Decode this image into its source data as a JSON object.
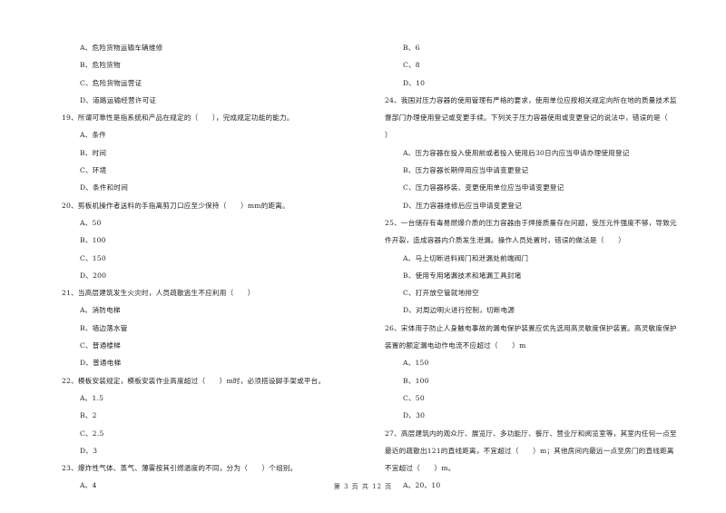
{
  "page": {
    "left_column": [
      {
        "type": "option",
        "text": "A、危险货物运输车辆维修"
      },
      {
        "type": "option",
        "text": "B、危险货物"
      },
      {
        "type": "option",
        "text": "C、危险货物运营证"
      },
      {
        "type": "option",
        "text": "D、道路运输经营许可证"
      },
      {
        "type": "question",
        "text": "19、所谓可靠性是指系统和产品在规定的（　　），完成规定功能的能力。"
      },
      {
        "type": "option",
        "text": "A、条件"
      },
      {
        "type": "option",
        "text": "B、时间"
      },
      {
        "type": "option",
        "text": "C、环境"
      },
      {
        "type": "option",
        "text": "D、条件和时间"
      },
      {
        "type": "question",
        "text": "20、剪板机操作者送料的手指离剪刀口应至少保持（　　）mm的距离。"
      },
      {
        "type": "option",
        "text": "A、50"
      },
      {
        "type": "option",
        "text": "B、100"
      },
      {
        "type": "option",
        "text": "C、150"
      },
      {
        "type": "option",
        "text": "D、200"
      },
      {
        "type": "question",
        "text": "21、当高层建筑发生火灾时，人员疏散逃生不应利用（　　）"
      },
      {
        "type": "option",
        "text": "A、消防电梯"
      },
      {
        "type": "option",
        "text": "B、墙边落水管"
      },
      {
        "type": "option",
        "text": "C、普通楼梯"
      },
      {
        "type": "option",
        "text": "D、普通电梯"
      },
      {
        "type": "question",
        "text": "22、模板安装规定，模板安装作业高度超过（　　）m时，必须搭设脚手架或平台。"
      },
      {
        "type": "option",
        "text": "A、1.5"
      },
      {
        "type": "option",
        "text": "B、2"
      },
      {
        "type": "option",
        "text": "C、2.5"
      },
      {
        "type": "option",
        "text": "D、3"
      },
      {
        "type": "question",
        "text": "23、爆炸性气体、蒸气、薄雾按其引燃温度的不同，分为（　　）个组别。"
      },
      {
        "type": "option",
        "text": "A、4"
      }
    ],
    "right_column": [
      {
        "type": "option",
        "text": "B、6"
      },
      {
        "type": "option",
        "text": "C、8"
      },
      {
        "type": "option",
        "text": "D、10"
      },
      {
        "type": "question",
        "text": "24、我国对压力容器的使用管理有严格的要求，使用单位应按相关规定向所在地的质量技术监"
      },
      {
        "type": "question",
        "text": "督部门办理使用登记或变更手续。下列关于压力容器使用或变更登记的说法中，错误的是（"
      },
      {
        "type": "question",
        "text": "）"
      },
      {
        "type": "option",
        "text": "A、压力容器在投入使用前或者投入使用后30日内应当申请办理使用登记"
      },
      {
        "type": "option",
        "text": "B、压力容器长期停用应当申请变更登记"
      },
      {
        "type": "option",
        "text": "C、压力容器移装、变更使用单位应当申请变更登记"
      },
      {
        "type": "option",
        "text": "D、压力容器维修后应当申请变更登记"
      },
      {
        "type": "question",
        "text": "25、一台储存有毒易燃爆介质的压力容器由于焊接质量存在问题，受压元件强度不够，导致元"
      },
      {
        "type": "question",
        "text": "件开裂，造成容器内介质发生泄漏。操作人员处置时，错误的做法是（　　）"
      },
      {
        "type": "option",
        "text": "A、马上切断进料阀门和泄漏处前端阀门"
      },
      {
        "type": "option",
        "text": "B、使用专用堵漏技术和堵漏工具封堵"
      },
      {
        "type": "option",
        "text": "C、打开放空管就地排空"
      },
      {
        "type": "option",
        "text": "D、对周边明火进行控制，切断电源"
      },
      {
        "type": "question",
        "text": "26、宋体用于防止人身触电事故的漏电保护装置应优先选用高灵敏度保护装置。高灵敏度保护"
      },
      {
        "type": "question",
        "text": "装置的额定漏电动作电流不应超过（　　）m"
      },
      {
        "type": "option",
        "text": "A、150"
      },
      {
        "type": "option",
        "text": "B、100"
      },
      {
        "type": "option",
        "text": "C、50"
      },
      {
        "type": "option",
        "text": "D、30"
      },
      {
        "type": "question",
        "text": "27、高层建筑内的观众厅、展览厅、多功能厅、餐厅、营业厅和阅览室等，其室内任何一点至"
      },
      {
        "type": "question",
        "text": "最近的疏散出121的直线距离，不宜超过（　　）m；其他房间内最远一点至房门的直线距离"
      },
      {
        "type": "question",
        "text": "不宜超过（　　）m。"
      },
      {
        "type": "option",
        "text": "A、20、10"
      }
    ],
    "footer": "第 3 页 共 12 页"
  }
}
